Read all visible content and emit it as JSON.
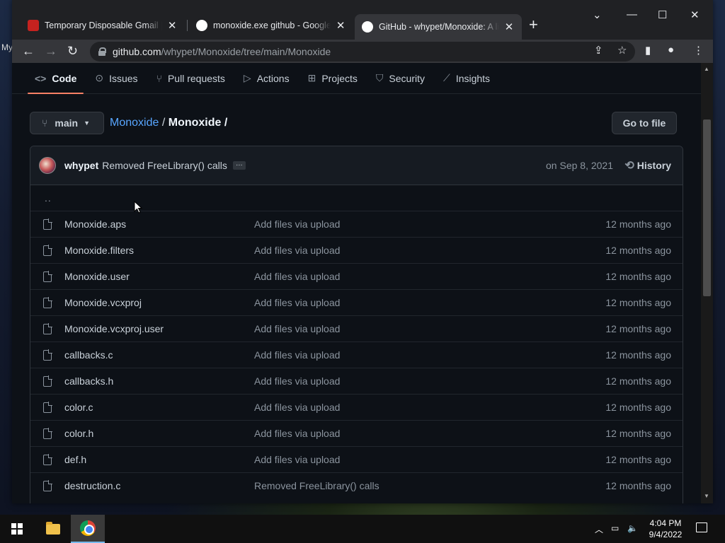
{
  "desktop": {
    "label": "My"
  },
  "browser": {
    "tabs": [
      {
        "title": "Temporary Disposable Gmail | Te",
        "favicon": "mail-icon",
        "favicon_color": "#c5221f"
      },
      {
        "title": "monoxide.exe github - Google S",
        "favicon": "google-icon",
        "favicon_color": "#ffffff"
      },
      {
        "title": "GitHub - whypet/Monoxide: A li",
        "favicon": "github-icon",
        "favicon_color": "#ffffff",
        "active": true
      }
    ],
    "new_tab": "+",
    "window_controls": {
      "dropdown": "⌄",
      "minimize": "—",
      "maximize": "☐",
      "close": "✕"
    },
    "nav": {
      "back": "←",
      "forward": "→",
      "reload": "↻"
    },
    "url": {
      "host": "github.com",
      "path": "/whypet/Monoxide/tree/main/Monoxide"
    }
  },
  "repo_nav": {
    "tabs": [
      {
        "label": "Code",
        "icon": "code-icon",
        "active": true
      },
      {
        "label": "Issues",
        "icon": "issue-icon"
      },
      {
        "label": "Pull requests",
        "icon": "pull-request-icon"
      },
      {
        "label": "Actions",
        "icon": "play-icon"
      },
      {
        "label": "Projects",
        "icon": "table-icon"
      },
      {
        "label": "Security",
        "icon": "shield-icon"
      },
      {
        "label": "Insights",
        "icon": "graph-icon"
      }
    ]
  },
  "branch": {
    "name": "main"
  },
  "breadcrumb": {
    "repo": "Monoxide",
    "sep": "/",
    "folder": "Monoxide",
    "trail": "/"
  },
  "goto_file": "Go to file",
  "commit": {
    "author": "whypet",
    "message": "Removed FreeLibrary() calls",
    "ellipsis": "…",
    "date": "on Sep 8, 2021",
    "history": "History"
  },
  "parent_dir": "..",
  "files": [
    {
      "name": "Monoxide.aps",
      "message": "Add files via upload",
      "age": "12 months ago"
    },
    {
      "name": "Monoxide.filters",
      "message": "Add files via upload",
      "age": "12 months ago"
    },
    {
      "name": "Monoxide.user",
      "message": "Add files via upload",
      "age": "12 months ago"
    },
    {
      "name": "Monoxide.vcxproj",
      "message": "Add files via upload",
      "age": "12 months ago"
    },
    {
      "name": "Monoxide.vcxproj.user",
      "message": "Add files via upload",
      "age": "12 months ago"
    },
    {
      "name": "callbacks.c",
      "message": "Add files via upload",
      "age": "12 months ago"
    },
    {
      "name": "callbacks.h",
      "message": "Add files via upload",
      "age": "12 months ago"
    },
    {
      "name": "color.c",
      "message": "Add files via upload",
      "age": "12 months ago"
    },
    {
      "name": "color.h",
      "message": "Add files via upload",
      "age": "12 months ago"
    },
    {
      "name": "def.h",
      "message": "Add files via upload",
      "age": "12 months ago"
    },
    {
      "name": "destruction.c",
      "message": "Removed FreeLibrary() calls",
      "age": "12 months ago"
    }
  ],
  "taskbar": {
    "time": "4:04 PM",
    "date": "9/4/2022"
  },
  "colors": {
    "accent": "#f78166",
    "link": "#58a6ff",
    "bg": "#0d1117"
  }
}
